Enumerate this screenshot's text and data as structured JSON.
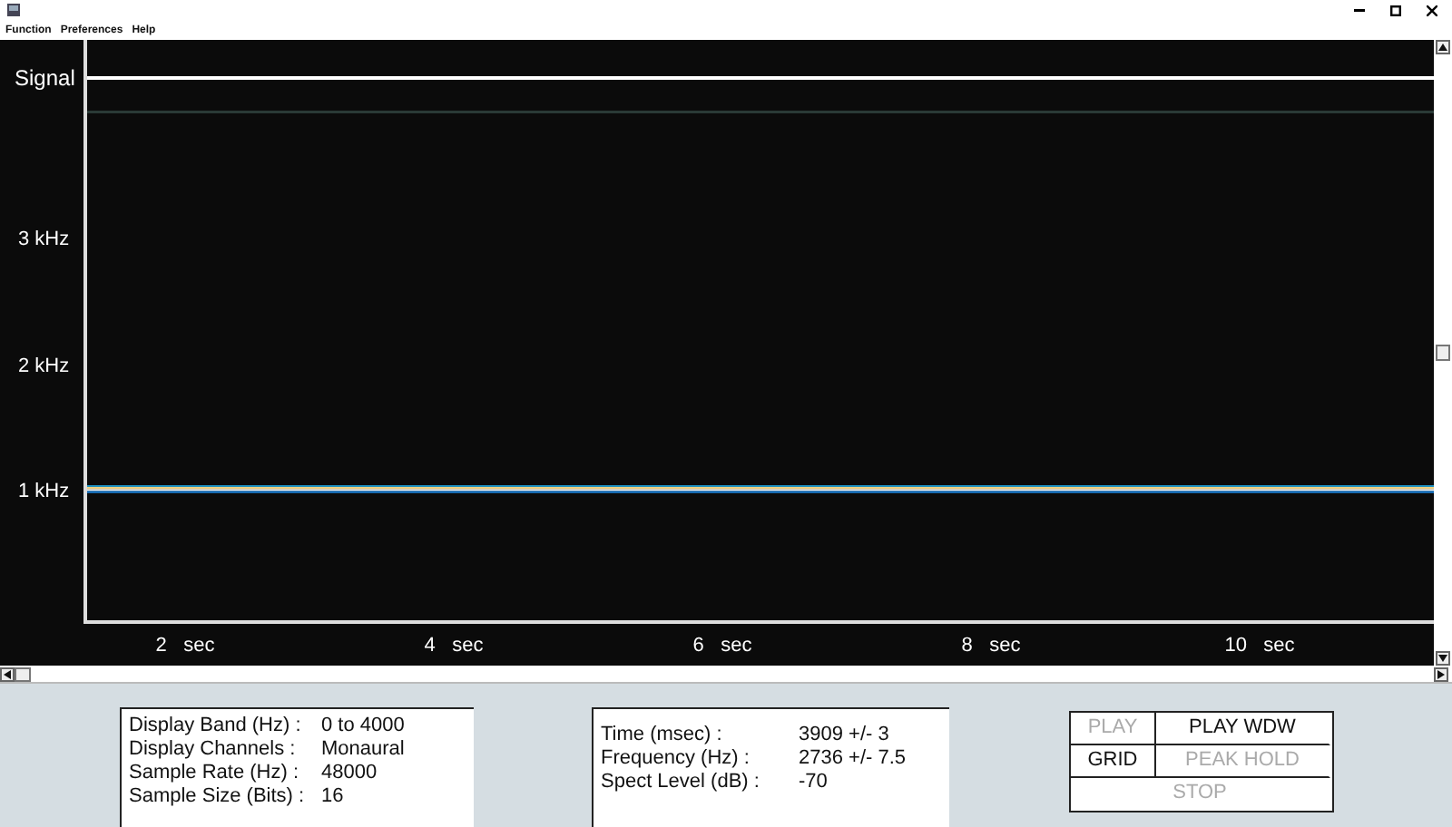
{
  "menu": [
    "Function",
    "Preferences",
    "Help"
  ],
  "signal_label": "Signal",
  "y_axis": [
    "3 kHz",
    "2 kHz",
    "1 kHz"
  ],
  "x_axis": [
    "2   sec",
    "4   sec",
    "6   sec",
    "8   sec",
    "10   sec"
  ],
  "info": [
    {
      "label": "Display Band (Hz) :",
      "value": "0 to 4000"
    },
    {
      "label": "Display Channels :",
      "value": "Monaural"
    },
    {
      "label": "Sample Rate (Hz) :",
      "value": "48000"
    },
    {
      "label": "Sample Size (Bits) :",
      "value": "16"
    }
  ],
  "readout": [
    {
      "label": "Time (msec) :",
      "value": "3909 +/- 3"
    },
    {
      "label": "Frequency (Hz) :",
      "value": "2736 +/- 7.5"
    },
    {
      "label": "Spect Level (dB) :",
      "value": "-70"
    }
  ],
  "buttons": [
    {
      "label": "PLAY",
      "disabled": true
    },
    {
      "label": "PLAY WDW",
      "disabled": false
    },
    {
      "label": "GRID",
      "disabled": false
    },
    {
      "label": "PEAK HOLD",
      "disabled": true
    },
    {
      "label": "STOP",
      "disabled": true
    }
  ]
}
